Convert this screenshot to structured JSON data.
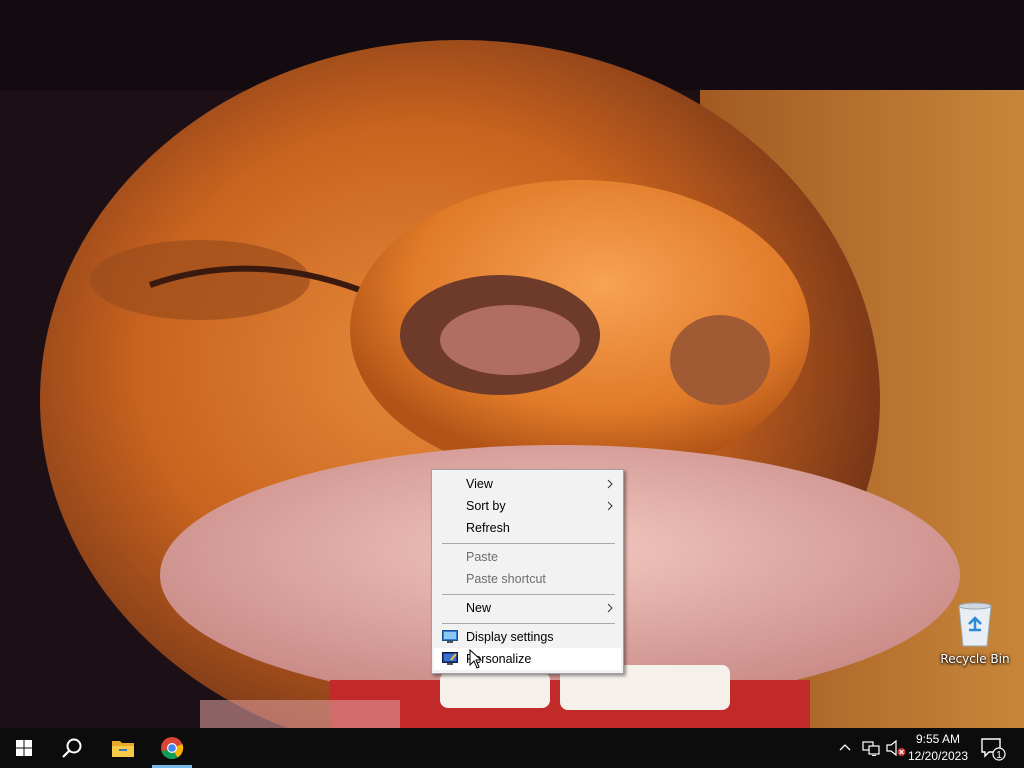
{
  "desktop": {
    "icons": [
      {
        "label": "Recycle Bin",
        "icon": "recycle-bin-icon"
      }
    ]
  },
  "context_menu": {
    "items": [
      {
        "label": "View",
        "submenu": true,
        "disabled": false
      },
      {
        "label": "Sort by",
        "submenu": true,
        "disabled": false
      },
      {
        "label": "Refresh",
        "submenu": false,
        "disabled": false
      },
      {
        "label": "Paste",
        "submenu": false,
        "disabled": true
      },
      {
        "label": "Paste shortcut",
        "submenu": false,
        "disabled": true
      },
      {
        "label": "New",
        "submenu": true,
        "disabled": false
      },
      {
        "label": "Display settings",
        "icon": "display-settings-icon",
        "disabled": false
      },
      {
        "label": "Personalize",
        "icon": "personalize-icon",
        "disabled": false,
        "hovered": true
      }
    ]
  },
  "taskbar": {
    "pinned": [
      {
        "name": "start",
        "icon": "windows-logo-icon"
      },
      {
        "name": "search",
        "icon": "search-icon"
      },
      {
        "name": "file-explorer",
        "icon": "folder-icon"
      },
      {
        "name": "chrome",
        "icon": "chrome-icon",
        "active": true
      }
    ],
    "tray": {
      "icons": [
        "chevron-up-icon",
        "network-icon",
        "volume-muted-icon"
      ],
      "time": "9:55 AM",
      "date": "12/20/2023",
      "notification_count": "1"
    }
  },
  "colors": {
    "taskbar_bg": "#0c0c0c",
    "menu_bg": "#f2f2f2",
    "active_underline": "#76b9ed"
  }
}
